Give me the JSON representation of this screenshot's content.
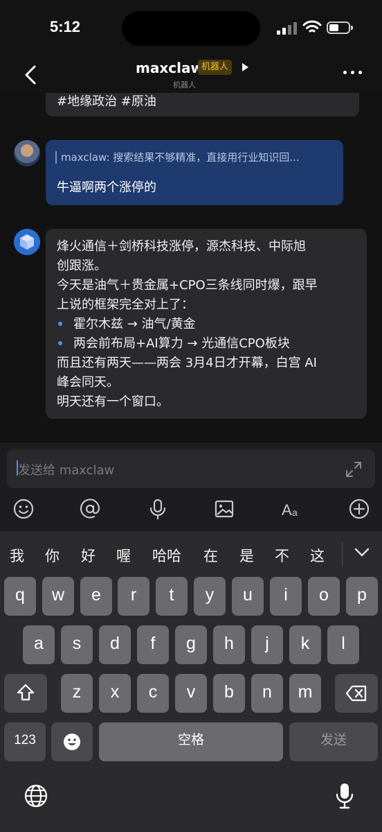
{
  "status_bar": {
    "time": "5:12"
  },
  "header": {
    "title": "maxclaw",
    "badge": "机器人",
    "subtitle": "机器人"
  },
  "messages": {
    "previous": "#地缘政治 #原油",
    "user": {
      "quote": "maxclaw: 搜索结果不够精准，直接用行业知识回...",
      "text": "牛逼啊两个涨停的"
    },
    "bot": {
      "lines": [
        "烽火通信＋剑桥科技涨停，源杰科技、中际旭",
        "创跟涨。",
        "今天是油气＋贵金属+CPO三条线同时爆，跟早",
        "上说的框架完全对上了：",
        "霍尔木兹 → 油气/黄金",
        "两会前布局+AI算力 → 光通信CPO板块",
        "而且还有两天——两会 3月4日才开幕，白宫 AI",
        "峰会同天。",
        "明天还有一个窗口。"
      ]
    }
  },
  "input": {
    "placeholder": "发送给 maxclaw"
  },
  "keyboard": {
    "candidates": [
      "我",
      "你",
      "好",
      "喔",
      "哈哈",
      "在",
      "是",
      "不",
      "这"
    ],
    "row1": [
      "q",
      "w",
      "e",
      "r",
      "t",
      "y",
      "u",
      "i",
      "o",
      "p"
    ],
    "row2": [
      "a",
      "s",
      "d",
      "f",
      "g",
      "h",
      "j",
      "k",
      "l"
    ],
    "row3": [
      "z",
      "x",
      "c",
      "v",
      "b",
      "n",
      "m"
    ],
    "num_label": "123",
    "space_label": "空格",
    "send_label": "发送"
  },
  "icons": {
    "toolbar": [
      "emoji-icon",
      "at-icon",
      "mic-icon",
      "image-icon",
      "font-icon",
      "add-icon"
    ],
    "accent": "#4f8ff7"
  }
}
